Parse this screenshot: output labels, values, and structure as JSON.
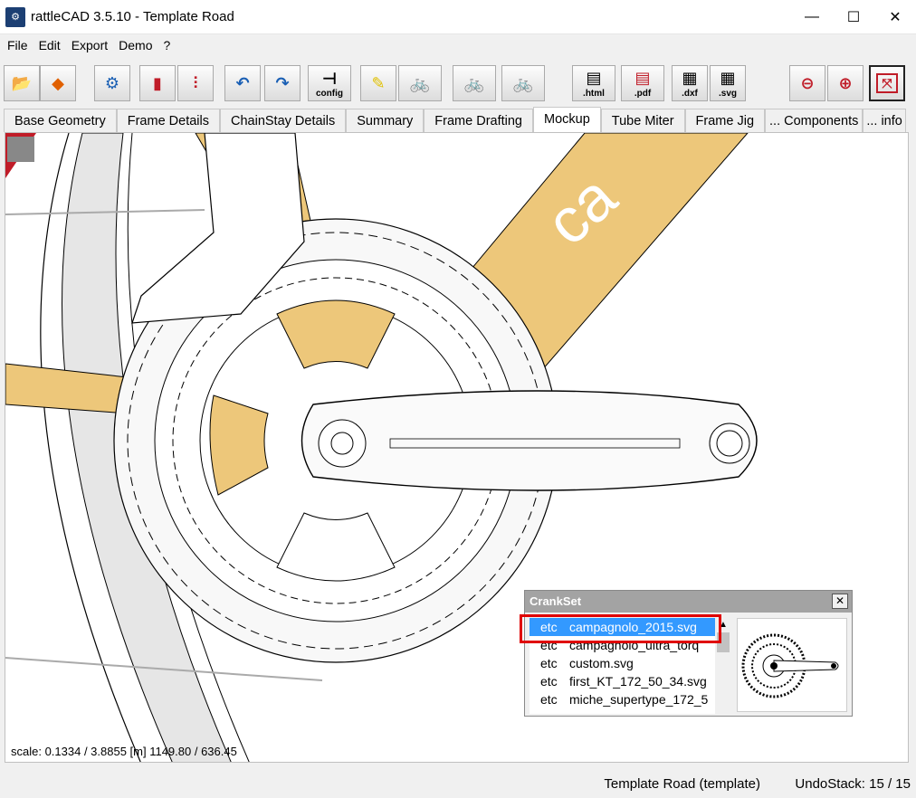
{
  "window": {
    "title": "rattleCAD  3.5.10 - Template Road",
    "controls": [
      "—",
      "☐",
      "✕"
    ]
  },
  "menu": [
    "File",
    "Edit",
    "Export",
    "Demo",
    "?"
  ],
  "toolbar": {
    "config_label": "config",
    "html_label": ".html",
    "pdf_label": ".pdf",
    "dxf_label": ".dxf",
    "svg_label": ".svg"
  },
  "tabs": [
    "Base Geometry",
    "Frame Details",
    "ChainStay Details",
    "Summary",
    "Frame Drafting",
    "Mockup",
    "Tube Miter",
    "Frame Jig",
    "... Components",
    "... info"
  ],
  "selected_tab": "Mockup",
  "canvas": {
    "scale_text": "scale: 0.1334 / 3.8855  [m]  1149.80 / 636.45"
  },
  "crankset_popup": {
    "title": "CrankSet",
    "close": "✕",
    "rows": [
      {
        "col1": "etc",
        "col2": "campagnolo_2015.svg",
        "selected": true
      },
      {
        "col1": "etc",
        "col2": "campagnolo_ultra_torq"
      },
      {
        "col1": "etc",
        "col2": "custom.svg"
      },
      {
        "col1": "etc",
        "col2": "first_KT_172_50_34.svg"
      },
      {
        "col1": "etc",
        "col2": "miche_supertype_172_5"
      }
    ]
  },
  "status": {
    "template": "Template Road (template)",
    "undo": "UndoStack: 15 / 15"
  },
  "colors": {
    "tube": "#edc77a",
    "selection": "#3399ff",
    "highlight": "#e00000"
  }
}
